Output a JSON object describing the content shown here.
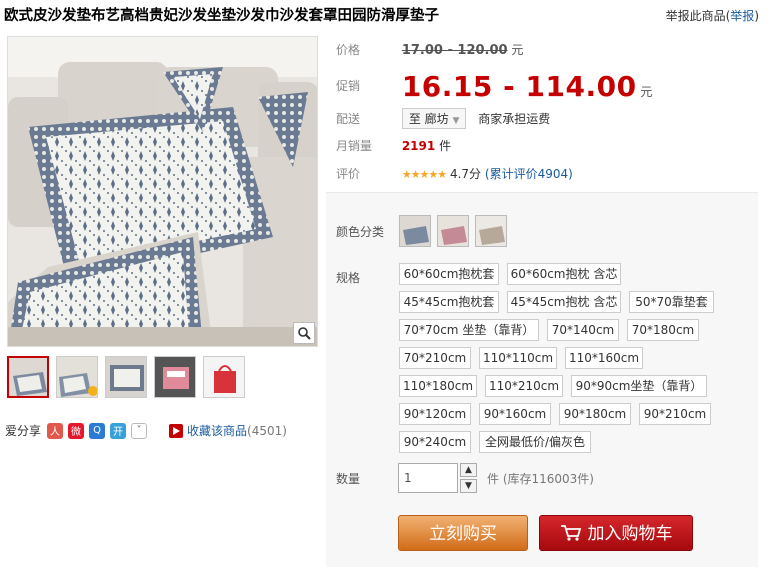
{
  "product": {
    "title": "欧式皮沙发垫布艺高档贵妃沙发坐垫沙发巾沙发套罩田园防滑厚垫子",
    "report_text": "举报此商品(",
    "report_link": "举报",
    "report_close": ")"
  },
  "price": {
    "label": "价格",
    "original": "17.00 - 120.00",
    "currency": "元"
  },
  "promo": {
    "label": "促销",
    "price": "16.15 - 114.00",
    "currency": "元"
  },
  "shipping": {
    "label": "配送",
    "location": "至 廊坊",
    "note": "商家承担运费"
  },
  "sales": {
    "label": "月销量",
    "count": "2191",
    "unit": "件"
  },
  "rating": {
    "label": "评价",
    "stars": "★★★★★",
    "score": "4.7分",
    "reviews": "(累计评价4904)"
  },
  "sku": {
    "color_label": "颜色分类",
    "spec_label": "规格",
    "specs": [
      "60*60cm抱枕套",
      "60*60cm抱枕 含芯",
      "45*45cm抱枕套",
      "45*45cm抱枕 含芯",
      "50*70靠垫套",
      "70*70cm 坐垫（靠背）",
      "70*140cm",
      "70*180cm",
      "70*210cm",
      "110*110cm",
      "110*160cm",
      "110*180cm",
      "110*210cm",
      "90*90cm坐垫（靠背）",
      "90*120cm",
      "90*160cm",
      "90*180cm",
      "90*210cm",
      "90*240cm",
      "全网最低价/偏灰色"
    ]
  },
  "quantity": {
    "label": "数量",
    "value": "1",
    "stock": "件 (库存116003件)"
  },
  "actions": {
    "buy": "立刻购买",
    "cart": "加入购物车"
  },
  "social": {
    "share_label": "爱分享",
    "fav_label": "收藏该商品",
    "fav_count": "(4501)"
  },
  "colors": {
    "accent": "#c40000",
    "buy": "#d26c17",
    "cart": "#b8121a",
    "link": "#1a5b9c"
  }
}
